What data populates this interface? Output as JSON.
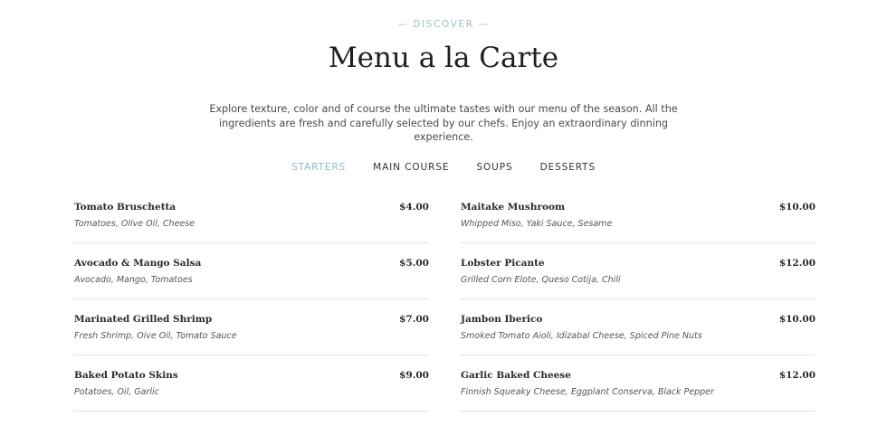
{
  "header": {
    "eyebrow": "— DISCOVER —",
    "title": "Menu a la Carte",
    "intro": "Explore texture, color and of course the ultimate tastes with our menu of the season. All the ingredients are fresh and carefully selected by our chefs. Enjoy an extraordinary dinning experience."
  },
  "tabs": [
    {
      "label": "STARTERS",
      "active": true
    },
    {
      "label": "MAIN COURSE",
      "active": false
    },
    {
      "label": "SOUPS",
      "active": false
    },
    {
      "label": "DESSERTS",
      "active": false
    }
  ],
  "menu": {
    "left": [
      {
        "name": "Tomato Bruschetta",
        "desc": "Tomatoes, Olive Oil, Cheese",
        "price": "$4.00"
      },
      {
        "name": "Avocado & Mango Salsa",
        "desc": "Avocado, Mango, Tomatoes",
        "price": "$5.00"
      },
      {
        "name": "Marinated Grilled Shrimp",
        "desc": "Fresh Shrimp, Oive Oil, Tomato Sauce",
        "price": "$7.00"
      },
      {
        "name": "Baked Potato Skins",
        "desc": "Potatoes, Oil, Garlic",
        "price": "$9.00"
      }
    ],
    "right": [
      {
        "name": "Maitake Mushroom",
        "desc": "Whipped Miso, Yaki Sauce, Sesame",
        "price": "$10.00"
      },
      {
        "name": "Lobster Picante",
        "desc": "Grilled Corn Elote, Queso Cotija, Chili",
        "price": "$12.00"
      },
      {
        "name": "Jambon Iberico",
        "desc": "Smoked Tomato Aioli, Idizabal Cheese, Spiced Pine Nuts",
        "price": "$10.00"
      },
      {
        "name": "Garlic Baked Cheese",
        "desc": "Finnish Squeaky Cheese, Eggplant Conserva, Black Pepper",
        "price": "$12.00"
      }
    ]
  }
}
